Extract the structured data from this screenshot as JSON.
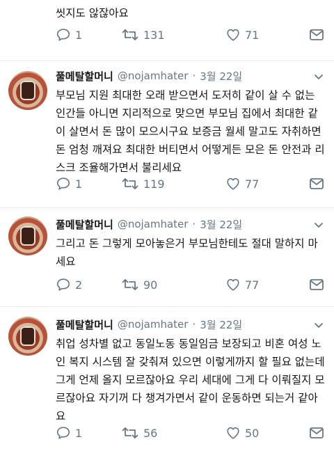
{
  "top_tweet": {
    "text": "씻지도 않잖아요",
    "replies": "1",
    "retweets": "131",
    "likes": "71"
  },
  "tweets": [
    {
      "name": "풀메탈할머니",
      "handle": "@nojamhater",
      "date": "3월 22일",
      "text": "부모님 지원 최대한 오래 받으면서 도저히 같이 살 수 없는 인간들 아니면 지리적으로 맞으면 부모님 집에서 최대한 같이 살면서 돈 많이 모으시구요 보증금 월세 말고도 자취하면 돈 엄청 깨져요 최대한 버티면서 어떻게든 모은 돈 안전과 리스크 조율해가면서 불리세요",
      "replies": "1",
      "retweets": "119",
      "likes": "77"
    },
    {
      "name": "풀메탈할머니",
      "handle": "@nojamhater",
      "date": "3월 22일",
      "text": "그리고 돈 그렇게 모아놓은거 부모님한테도 절대 말하지 마세요",
      "replies": "2",
      "retweets": "90",
      "likes": "77"
    },
    {
      "name": "풀메탈할머니",
      "handle": "@nojamhater",
      "date": "3월 22일",
      "text": "취업 성차별 없고 동일노동 동일임금 보장되고 비혼 여성 노인 복지 시스템 잘 갖춰져 있으면 이렇게까지 할 필요 없는데 그게 언제 올지 모르잖아요 우리 세대에 그게 다 이뤄질지 모르잖아요 자기꺼 다 챙겨가면서 같이 운동하면 되는거 같아요",
      "replies": "1",
      "retweets": "56",
      "likes": "50"
    }
  ],
  "icons": {
    "reply": "reply-icon",
    "retweet": "retweet-icon",
    "like": "heart-icon",
    "dm": "mail-icon",
    "menu": "chevron-down-icon"
  },
  "colors": {
    "text": "#14171a",
    "secondary": "#657786",
    "divider": "#e6ecf0"
  }
}
